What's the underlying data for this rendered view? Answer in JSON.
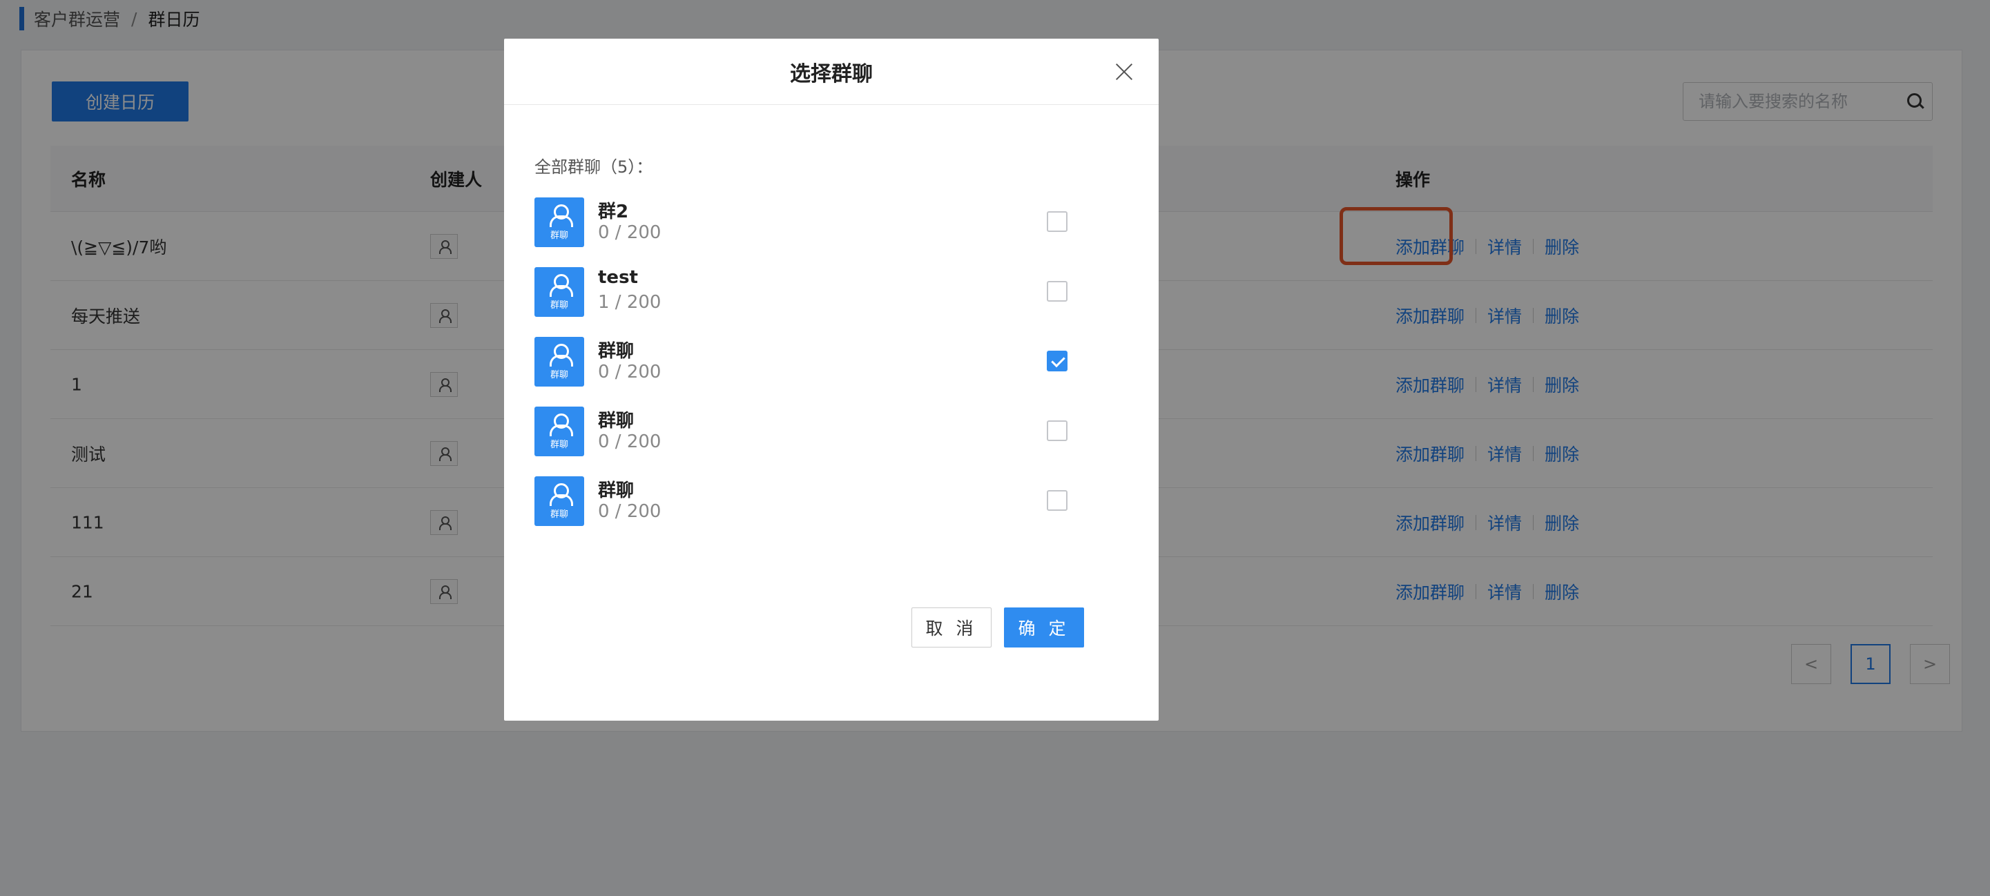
{
  "breadcrumb": {
    "parent": "客户群运营",
    "separator": "/",
    "current": "群日历"
  },
  "toolbar": {
    "create_label": "创建日历",
    "search_placeholder": "请输入要搜索的名称"
  },
  "table": {
    "headers": {
      "name": "名称",
      "creator": "创建人",
      "ops": "操作"
    },
    "ops": {
      "add": "添加群聊",
      "detail": "详情",
      "delete": "删除"
    },
    "rows": [
      {
        "name": "\\(≧▽≦)/7哟"
      },
      {
        "name": "每天推送"
      },
      {
        "name": "1"
      },
      {
        "name": "测试"
      },
      {
        "name": "111"
      },
      {
        "name": "21"
      }
    ]
  },
  "pagination": {
    "prev": "<",
    "page": "1",
    "next": ">"
  },
  "modal": {
    "title": "选择群聊",
    "count_label": "全部群聊（5）：",
    "avatar_label": "群聊",
    "groups": [
      {
        "name": "群2",
        "count": "0 / 200",
        "checked": false
      },
      {
        "name": "test",
        "count": "1 / 200",
        "checked": false
      },
      {
        "name": "群聊",
        "count": "0 / 200",
        "checked": true
      },
      {
        "name": "群聊",
        "count": "0 / 200",
        "checked": false
      },
      {
        "name": "群聊",
        "count": "0 / 200",
        "checked": false
      }
    ],
    "cancel_label": "取 消",
    "ok_label": "确 定"
  },
  "colors": {
    "accent": "#2f8cf0",
    "highlight": "#e8572a"
  }
}
